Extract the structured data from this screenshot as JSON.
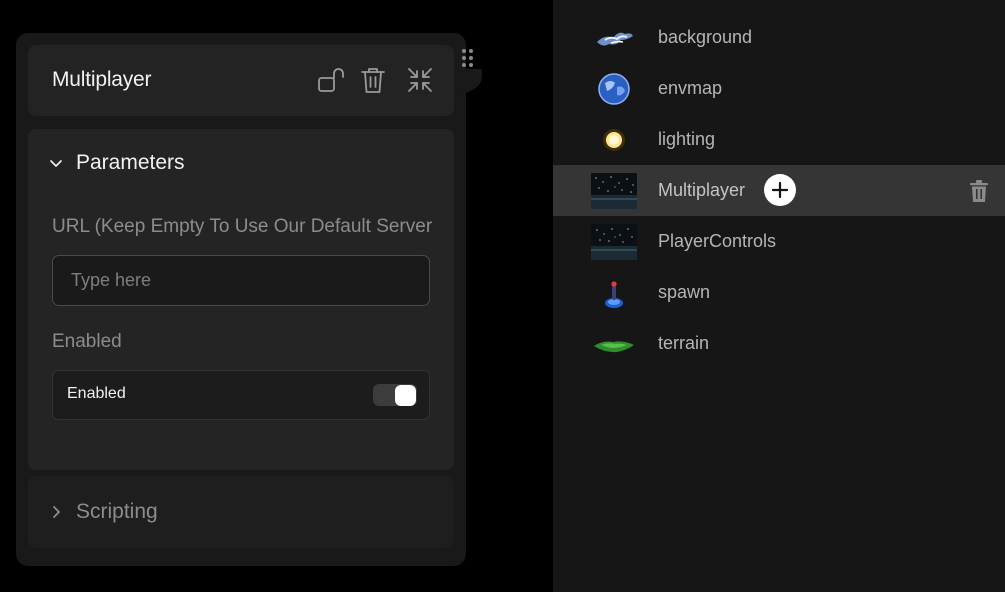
{
  "panel": {
    "title": "Multiplayer",
    "parameters": {
      "section_title": "Parameters",
      "url_label": "URL (Keep Empty To Use Our Default Server)",
      "url_placeholder": "Type here",
      "url_value": "",
      "enabled_label": "Enabled",
      "enabled_toggle_label": "Enabled",
      "enabled_value": true
    },
    "scripting": {
      "section_title": "Scripting"
    },
    "header_icons": [
      "unlock-icon",
      "trash-icon",
      "collapse-icon"
    ]
  },
  "scene": {
    "items": [
      {
        "label": "background",
        "icon": "background-thumbnail"
      },
      {
        "label": "envmap",
        "icon": "envmap-thumbnail"
      },
      {
        "label": "lighting",
        "icon": "light-bulb-thumbnail"
      },
      {
        "label": "Multiplayer",
        "icon": "multiplayer-thumbnail",
        "selected": true
      },
      {
        "label": "PlayerControls",
        "icon": "player-controls-thumbnail"
      },
      {
        "label": "spawn",
        "icon": "spawn-thumbnail"
      },
      {
        "label": "terrain",
        "icon": "terrain-thumbnail"
      }
    ]
  },
  "colors": {
    "page_background": "#000000",
    "panel_background": "#191919",
    "card_background": "#242424",
    "selected_row": "#353535",
    "text_primary": "#f2f2f2",
    "text_muted": "#8c8c8c"
  }
}
